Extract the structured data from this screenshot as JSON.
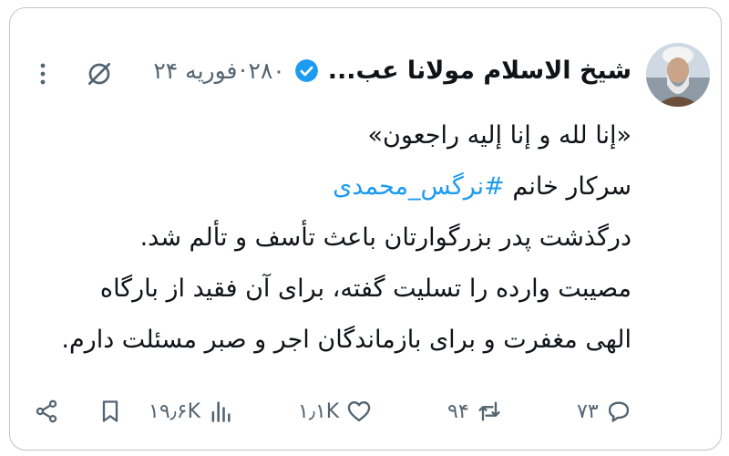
{
  "author": {
    "name": "شیخ الاسلام مولانا عب...",
    "verified": true,
    "handle": "۲۸۰",
    "separator": "·",
    "date": "فوریه ۲۴"
  },
  "tweet": {
    "line1": "«إنا لله و إنا إليه راجعون»",
    "line2_prefix": "سرکار خانم ",
    "hashtag": "#نرگس_محمدی",
    "line3": "درگذشت پدر بزرگوارتان باعث تأسف و تألم شد.",
    "line4": "مصیبت وارده را تسلیت گفته، برای آن فقید از بارگاه",
    "line5": "الهی مغفرت و برای بازماندگان اجر و صبر مسئلت دارم."
  },
  "actions": {
    "replies": "۷۳",
    "reposts": "۹۴",
    "likes": "۱٫۱K",
    "views": "۱۹٫۶K"
  },
  "icons": {
    "reply": "reply-icon",
    "repost": "repost-icon",
    "like": "heart-icon",
    "views": "views-icon",
    "bookmark": "bookmark-icon",
    "share": "share-icon",
    "grok": "grok-icon",
    "more": "more-icon",
    "verified": "verified-badge-icon"
  },
  "colors": {
    "text": "#0f1419",
    "secondary": "#536471",
    "accent": "#1d9bf0"
  }
}
